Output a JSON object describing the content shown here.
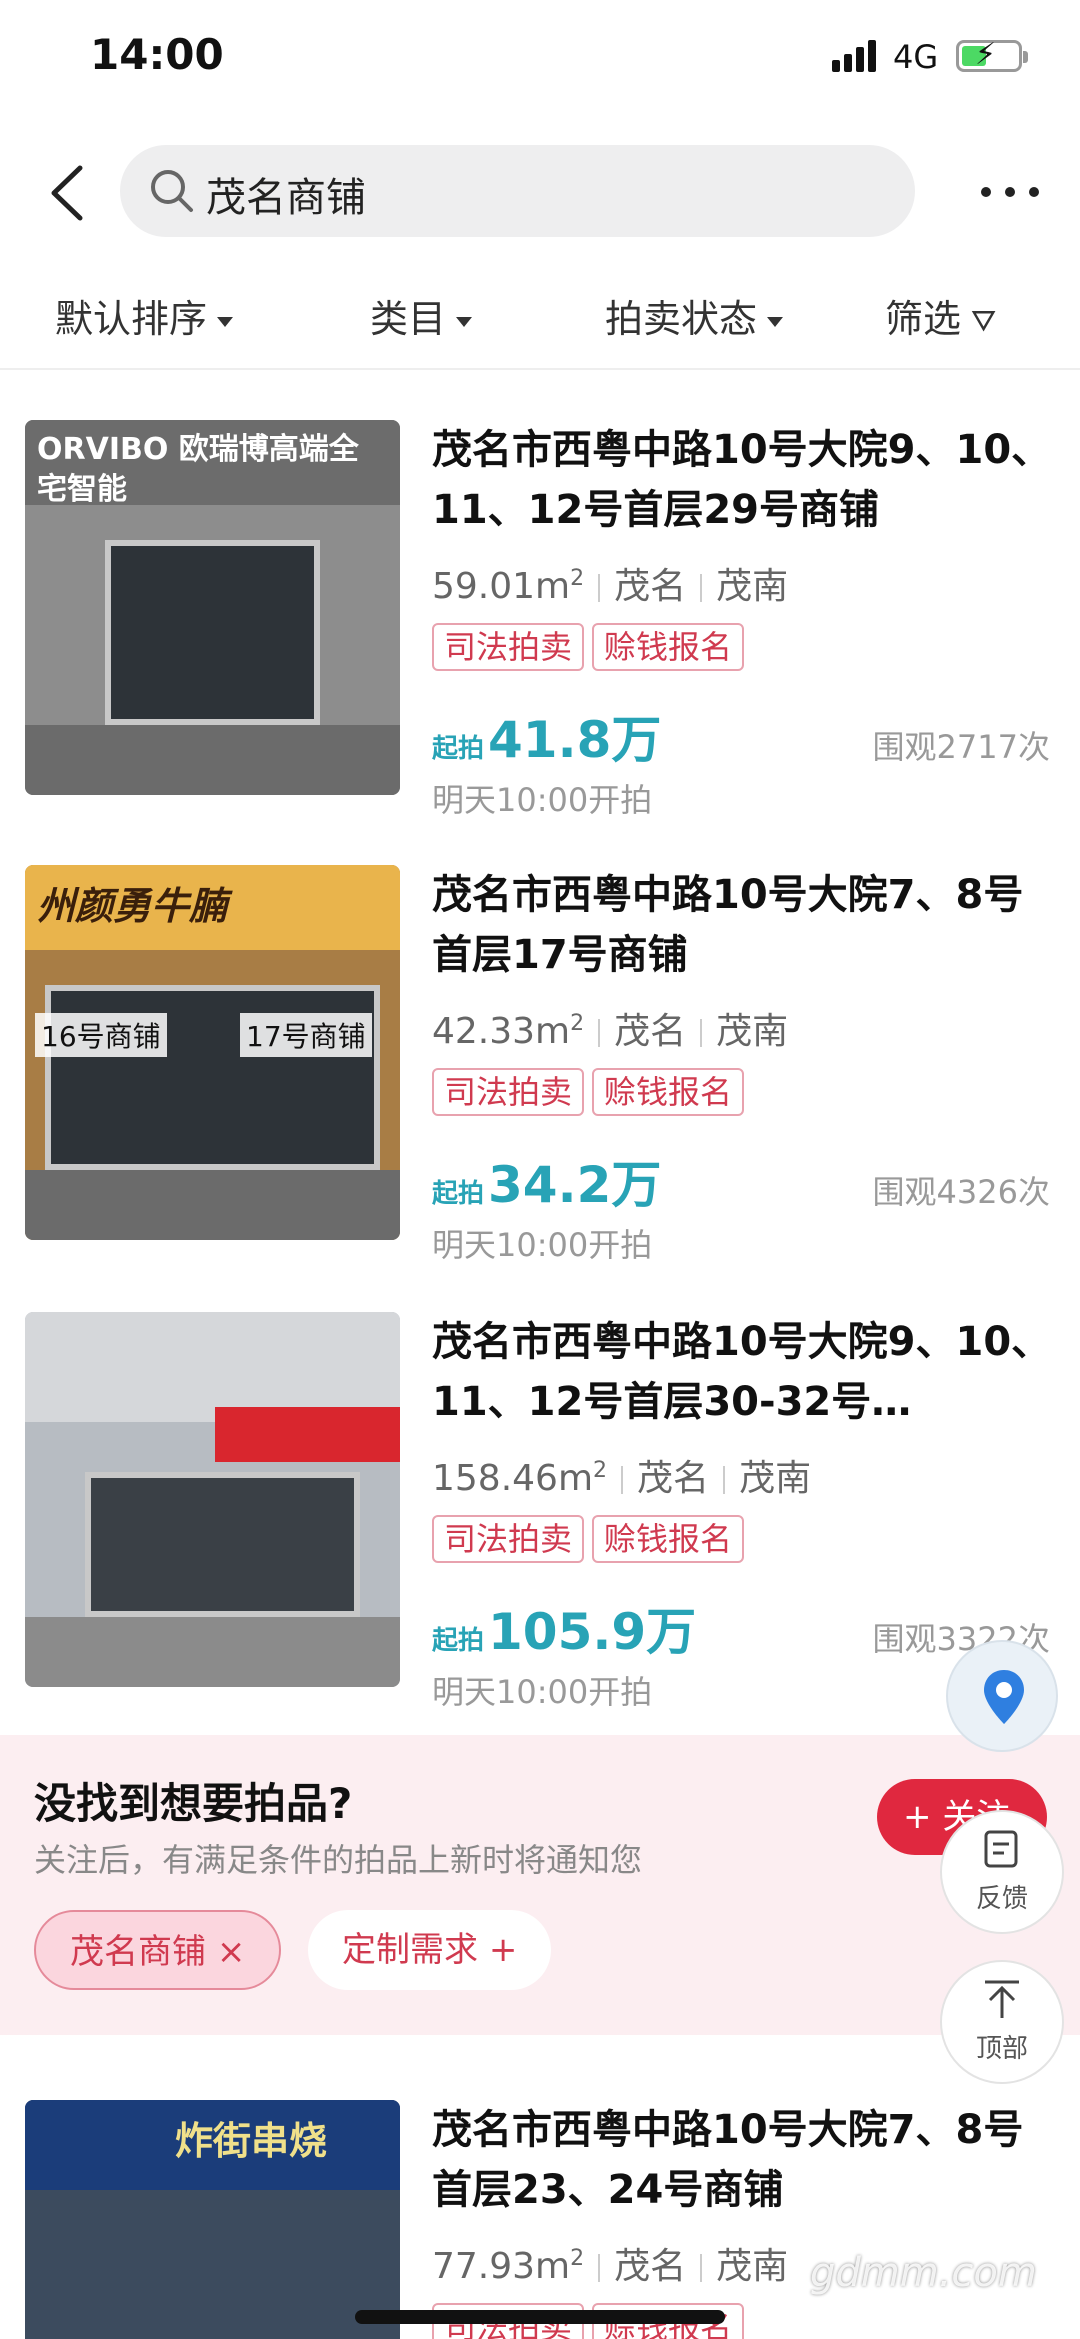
{
  "status": {
    "time": "14:00",
    "network": "4G"
  },
  "search": {
    "query": "茂名商铺"
  },
  "filters": [
    {
      "label": "默认排序"
    },
    {
      "label": "类目"
    },
    {
      "label": "拍卖状态"
    },
    {
      "label": "筛选"
    }
  ],
  "listings": [
    {
      "title": "茂名市西粤中路10号大院9、10、11、12号首层29号商铺",
      "area": "59.01m",
      "area_unit": "2",
      "city": "茂名",
      "district": "茂南",
      "tags": [
        "司法拍卖",
        "赊钱报名"
      ],
      "price_prefix": "起拍",
      "price": "41.8万",
      "views": "围观2717次",
      "start_time": "明天10:00开拍",
      "image_text": "ORVIBO 欧瑞博高端全宅智能"
    },
    {
      "title": "茂名市西粤中路10号大院7、8号首层17号商铺",
      "area": "42.33m",
      "area_unit": "2",
      "city": "茂名",
      "district": "茂南",
      "tags": [
        "司法拍卖",
        "赊钱报名"
      ],
      "price_prefix": "起拍",
      "price": "34.2万",
      "views": "围观4326次",
      "start_time": "明天10:00开拍",
      "image_text": "州颜勇牛腩",
      "image_labels": [
        "16号商铺",
        "17号商铺"
      ]
    },
    {
      "title": "茂名市西粤中路10号大院9、10、11、12号首层30-32号…",
      "area": "158.46m",
      "area_unit": "2",
      "city": "茂名",
      "district": "茂南",
      "tags": [
        "司法拍卖",
        "赊钱报名"
      ],
      "price_prefix": "起拍",
      "price": "105.9万",
      "views": "围观3322次",
      "start_time": "明天10:00开拍"
    },
    {
      "title": "茂名市西粤中路10号大院7、8号首层23、24号商铺",
      "area": "77.93m",
      "area_unit": "2",
      "city": "茂名",
      "district": "茂南",
      "tags": [
        "司法拍卖",
        "赊钱报名"
      ],
      "image_text": "炸街串烧"
    }
  ],
  "subscribe": {
    "title": "没找到想要拍品?",
    "desc": "关注后，有满足条件的拍品上新时将通知您",
    "chip_keyword": "茂名商铺",
    "chip_custom": "定制需求",
    "follow_label": "关注"
  },
  "floating": {
    "feedback": "反馈",
    "top": "顶部"
  },
  "watermark": "gdmm.com",
  "colors": {
    "accent": "#28a3b6",
    "brand_red": "#e0283f",
    "tag_red": "#d03a4f"
  }
}
